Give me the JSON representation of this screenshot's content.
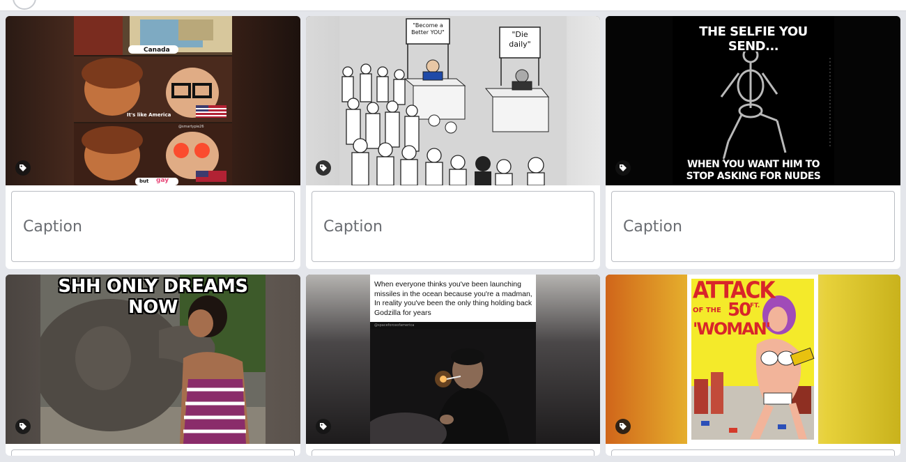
{
  "caption_placeholder": "Caption",
  "cards": [
    {
      "labels": [
        "Canada",
        "It's like America",
        "but",
        "gay"
      ],
      "watermark": "@smartypie26"
    },
    {
      "signs": [
        "\"Become a Better YOU\"",
        "\"Die daily\""
      ]
    },
    {
      "top_text": "THE SELFIE YOU SEND...",
      "bottom_text": "WHEN YOU WANT HIM TO STOP ASKING FOR NUDES"
    },
    {
      "top_text": "SHH ONLY DREAMS NOW"
    },
    {
      "caption_text": "When everyone thinks you've been launching missiles in the ocean because you're a madman, In reality you've been the only thing holding back Godzilla for years",
      "watermark": "@spaceforceofamerica"
    },
    {
      "poster_line1": "ATTACK",
      "poster_line2": "OF THE",
      "poster_line3": "50",
      "poster_line4": "FT.",
      "poster_line5": "'WOMAN'"
    }
  ],
  "icons": {
    "tag": "tag-icon"
  },
  "colors": {
    "background": "#e4e6eb",
    "card": "#ffffff",
    "input_border": "#b9bcc2"
  }
}
